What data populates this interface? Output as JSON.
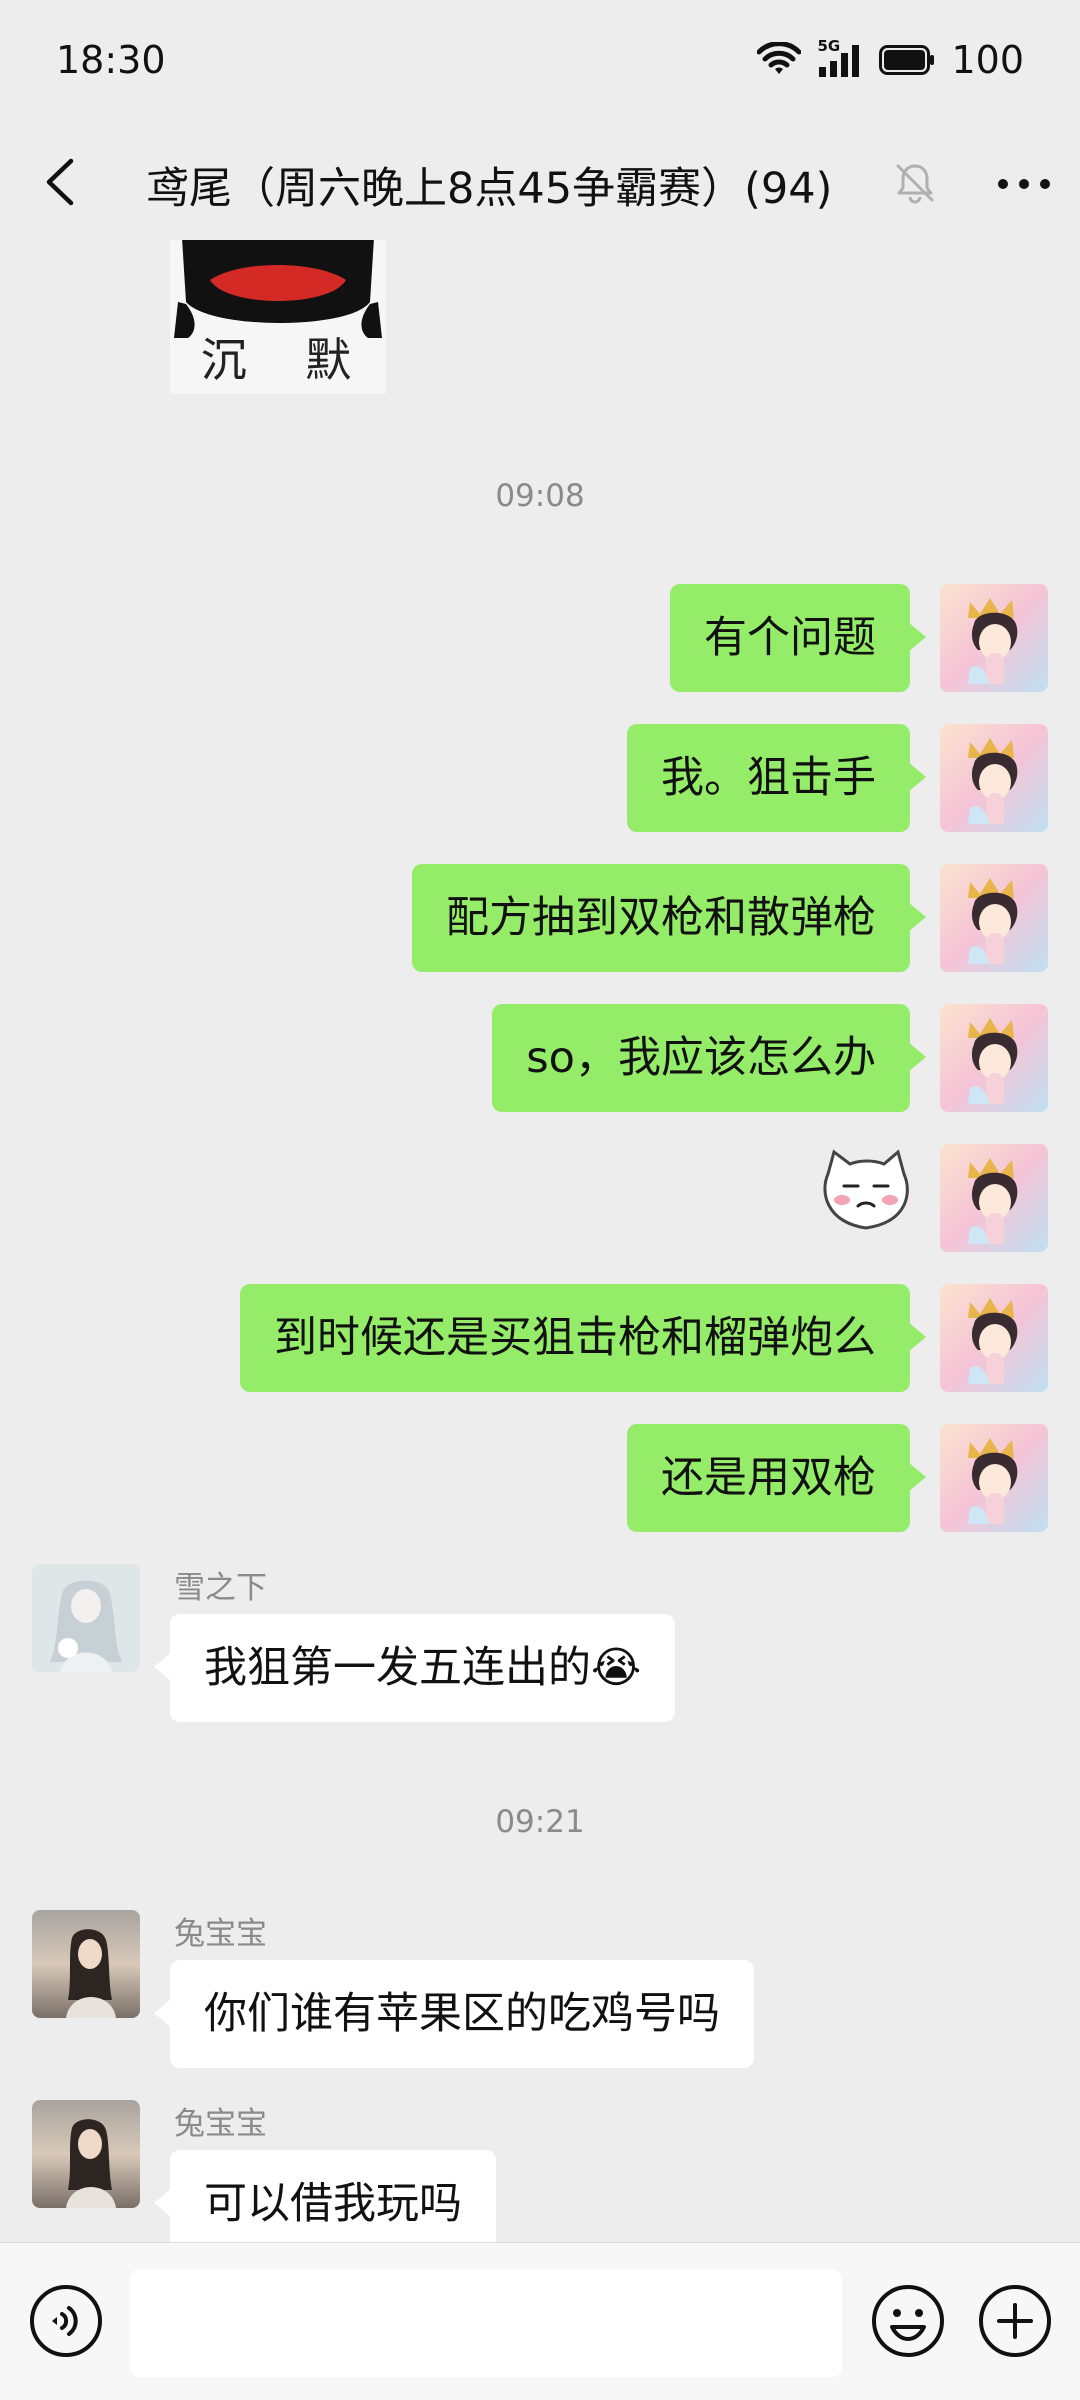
{
  "status_bar": {
    "time": "18:30",
    "network": "5G",
    "battery": "100"
  },
  "nav": {
    "title": "鸢尾（周六晚上8点45争霸赛）(94)"
  },
  "stickers": {
    "silent_text": "沉 默"
  },
  "timestamps": [
    "09:08",
    "09:21"
  ],
  "my_messages": [
    "有个问题",
    "我。狙击手",
    "配方抽到双枪和散弹枪",
    "so，我应该怎么办",
    "到时候还是买狙击枪和榴弹炮么",
    "还是用双枪"
  ],
  "others": [
    {
      "name": "雪之下",
      "message": "我狙第一发五连出的😭"
    },
    {
      "name": "兔宝宝",
      "message": "你们谁有苹果区的吃鸡号吗"
    },
    {
      "name": "兔宝宝",
      "message": "可以借我玩吗"
    }
  ],
  "input": {
    "placeholder": ""
  },
  "colors": {
    "my_bubble": "#95ec69",
    "their_bubble": "#ffffff",
    "background": "#ededed"
  }
}
